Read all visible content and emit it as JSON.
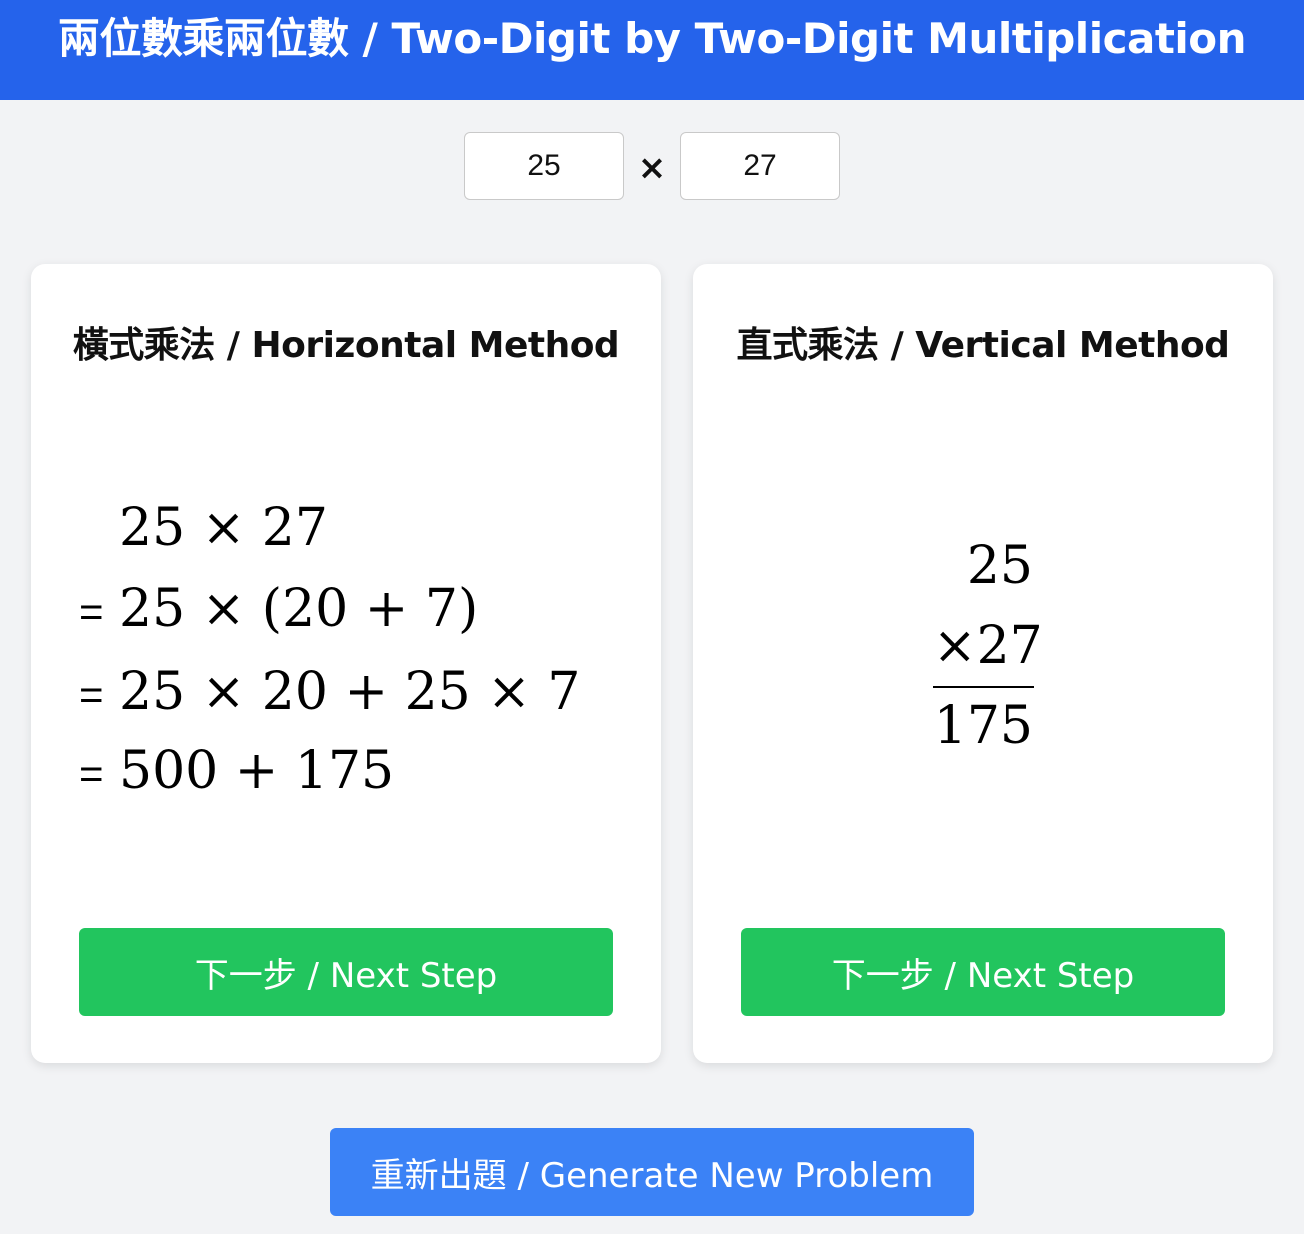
{
  "header": {
    "title": "兩位數乘兩位數 / Two-Digit by Two-Digit Multiplication"
  },
  "inputs": {
    "a": "25",
    "times": "×",
    "b": "27"
  },
  "horizontal": {
    "title": "橫式乘法 / Horizontal Method",
    "lines": [
      {
        "prefix": "",
        "expr": "25 × 27"
      },
      {
        "prefix": "=",
        "expr": "25 × (20 + 7)"
      },
      {
        "prefix": "=",
        "expr": "25 × 20 + 25 × 7"
      },
      {
        "prefix": "=",
        "expr": "500 + 175"
      }
    ],
    "next_label": "下一步 / Next Step"
  },
  "vertical": {
    "title": "直式乘法 / Vertical Method",
    "top": "25",
    "multiplier": "×27",
    "partial": "175",
    "next_label": "下一步 / Next Step"
  },
  "generate_label": "重新出題 / Generate New Problem",
  "colors": {
    "header": "#2563eb",
    "step_button": "#22c55e",
    "generate_button": "#3b82f6",
    "background": "#f2f3f5"
  }
}
